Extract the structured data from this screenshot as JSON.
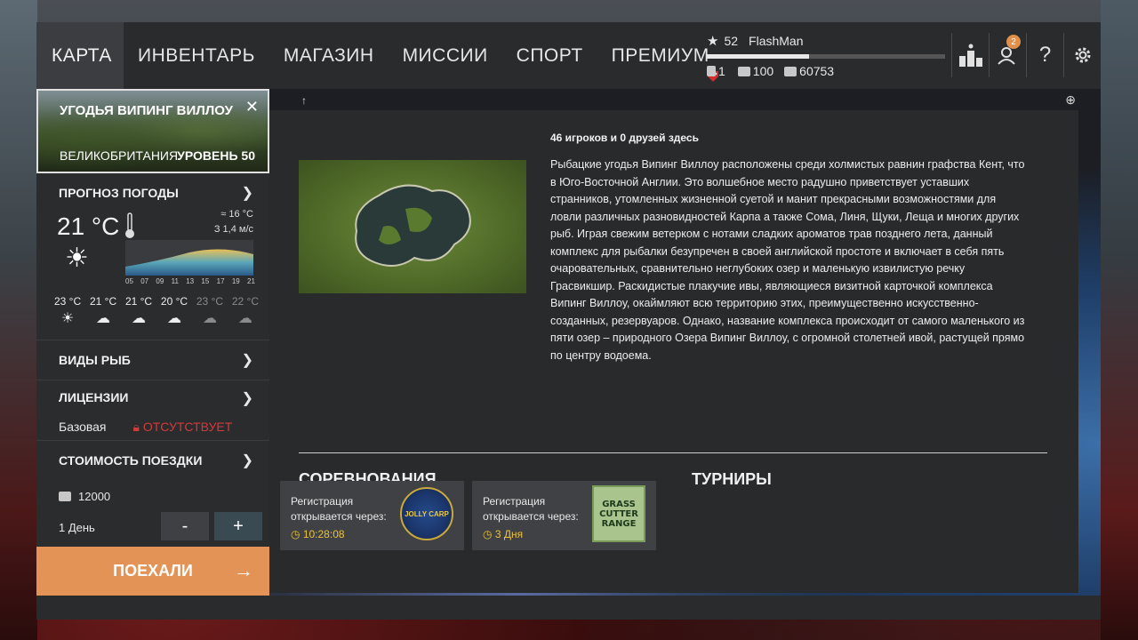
{
  "nav": {
    "tabs": [
      {
        "label": "КАРТА",
        "active": true
      },
      {
        "label": "ИНВЕНТАРЬ"
      },
      {
        "label": "МАГАЗИН"
      },
      {
        "label": "МИССИИ"
      },
      {
        "label": "СПОРТ"
      },
      {
        "label": "ПРЕМИУМ"
      }
    ]
  },
  "profile": {
    "level": "52",
    "name": "FlashMan",
    "xp_fraction": 0.43,
    "tokens": "1",
    "silver": "100",
    "credits": "60753"
  },
  "top_icons": {
    "friends_badge": "2",
    "help": "?"
  },
  "location": {
    "title": "УГОДЬЯ ВИПИНГ ВИЛЛОУ",
    "country": "ВЕЛИКОБРИТАНИЯ",
    "level": "УРОВЕНЬ 50"
  },
  "weather": {
    "title": "ПРОГНОЗ ПОГОДЫ",
    "temp": "21 °C",
    "water_temp": "16 °C",
    "wind": "З 1,4 м/с",
    "hours": [
      "05",
      "07",
      "09",
      "11",
      "13",
      "15",
      "17",
      "19",
      "21"
    ],
    "forecast": [
      {
        "temp": "23 °C",
        "icon": "sun-icon",
        "glyph": "☀",
        "dim": false
      },
      {
        "temp": "21 °C",
        "icon": "cloud-icon",
        "glyph": "☁",
        "dim": false
      },
      {
        "temp": "21 °C",
        "icon": "cloud-icon",
        "glyph": "☁",
        "dim": false
      },
      {
        "temp": "20 °C",
        "icon": "cloud-icon",
        "glyph": "☁",
        "dim": false
      },
      {
        "temp": "23 °C",
        "icon": "cloud-icon",
        "glyph": "☁",
        "dim": true
      },
      {
        "temp": "22 °C",
        "icon": "cloud-icon",
        "glyph": "☁",
        "dim": true
      }
    ]
  },
  "fish": {
    "title": "ВИДЫ РЫБ"
  },
  "license": {
    "title": "ЛИЦЕНЗИИ",
    "type": "Базовая",
    "status": "ОТСУТСТВУЕТ"
  },
  "trip": {
    "title": "СТОИМОСТЬ ПОЕЗДКИ",
    "price": "12000",
    "days": "1 День",
    "minus": "-",
    "plus": "+"
  },
  "go_button": {
    "label": "ПОЕХАЛИ",
    "arrow": "→"
  },
  "info": {
    "players": "46 игроков и 0 друзей здесь",
    "description": "Рыбацкие угодья Випинг Виллоу расположены среди холмистых равнин графства Кент, что в Юго-Восточной Англии. Это волшебное место радушно приветствует уставших странников, утомленных жизненной суетой и манит прекрасными возможностями для ловли различных разновидностей Карпа а также Сома, Линя, Щуки, Леща и многих других рыб. Играя свежим ветерком с нотами сладких ароматов трав позднего лета, данный комплекс для рыбалки безупречен в своей английской простоте и включает в себя пять очаровательных, сравнительно неглубоких озер и маленькую извилистую речку Грасвикшир. Раскидистые плакучие ивы, являющиеся визитной карточкой комплекса Випинг Виллоу, окаймляют всю территорию этих, преимущественно искусственно-созданных, резервуаров. Однако, название комплекса происходит от самого маленького из пяти озер – природного Озера Випинг Виллоу, с огромной столетней ивой, растущей прямо по центру водоема."
  },
  "competitions": {
    "title": "СОРЕВНОВАНИЯ",
    "cards": [
      {
        "text": "Регистрация открывается через:",
        "timer": "10:28:08",
        "logo": "JOLLY CARP"
      },
      {
        "text": "Регистрация открывается через:",
        "timer": "3 Дня",
        "logo_lines": [
          "GRASS",
          "CUTTER",
          "RANGE"
        ]
      }
    ]
  },
  "tournaments": {
    "title": "ТУРНИРЫ"
  },
  "colors": {
    "accent_orange": "#e39355",
    "timer_yellow": "#e9c23a",
    "license_red": "#d43a3a"
  }
}
